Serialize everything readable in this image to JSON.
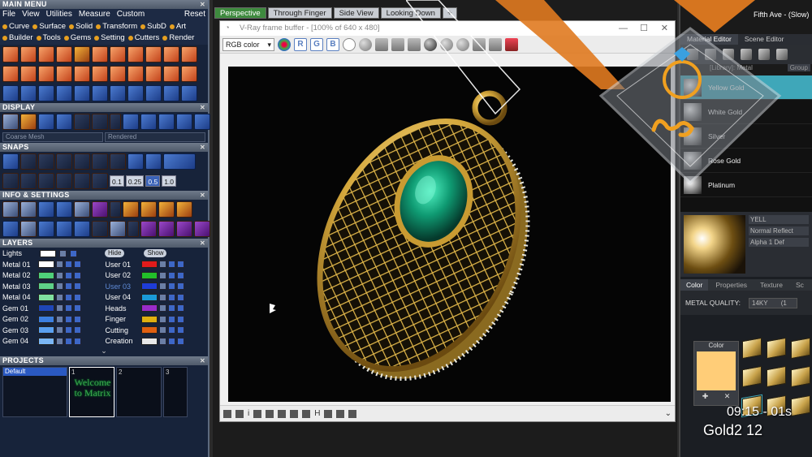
{
  "main_menu": {
    "title": "MAIN MENU",
    "menus": [
      "File",
      "View",
      "Utilities",
      "Measure",
      "Custom"
    ],
    "reset": "Reset",
    "submenus": [
      "Curve",
      "Surface",
      "Solid",
      "Transform",
      "SubD",
      "Art",
      "Builder",
      "Tools",
      "Gems",
      "Setting",
      "Cutters",
      "Render"
    ]
  },
  "display": {
    "title": "DISPLAY",
    "mesh_select": "Coarse Mesh",
    "render_select": "Rendered"
  },
  "snaps": {
    "title": "SNAPS",
    "values": [
      "0.1",
      "0.25",
      "0.5",
      "1.0"
    ]
  },
  "info": {
    "title": "INFO & SETTINGS"
  },
  "layers": {
    "title": "LAYERS",
    "lights": "Lights",
    "hide": "Hide",
    "show": "Show",
    "left": [
      {
        "name": "Metal 01",
        "color": "#ffffff"
      },
      {
        "name": "Metal 02",
        "color": "#4fd07a"
      },
      {
        "name": "Metal 03",
        "color": "#5ed088"
      },
      {
        "name": "Metal 04",
        "color": "#7fe0a0"
      },
      {
        "name": "Gem 01",
        "color": "#1e46b8"
      },
      {
        "name": "Gem 02",
        "color": "#3c7fe0"
      },
      {
        "name": "Gem 03",
        "color": "#5aa0f0"
      },
      {
        "name": "Gem 04",
        "color": "#7ab6f5"
      }
    ],
    "right": [
      {
        "name": "User 01",
        "color": "#e11b1b"
      },
      {
        "name": "User 02",
        "color": "#22c02a"
      },
      {
        "name": "User 03",
        "color": "#1e3cd8"
      },
      {
        "name": "User 04",
        "color": "#1a9ad8"
      },
      {
        "name": "Heads",
        "color": "#9a2cc8"
      },
      {
        "name": "Finger",
        "color": "#e0b010"
      },
      {
        "name": "Cutting",
        "color": "#e06010"
      },
      {
        "name": "Creation",
        "color": "#e8e8e8"
      }
    ]
  },
  "projects": {
    "title": "PROJECTS",
    "default": "Default",
    "slots": [
      "1",
      "2",
      "3"
    ],
    "welcome": "Welcome to Matrix"
  },
  "viewport_tabs": [
    "Perspective",
    "Through Finger",
    "Side View",
    "Looking Down",
    "+"
  ],
  "vray": {
    "title": "V-Ray frame buffer - [100% of 640 x 480]",
    "channel": "RGB color",
    "r": "R",
    "g": "G",
    "b": "B"
  },
  "right_panel": {
    "title": "Fifth Ave - (Slow)",
    "tabs": [
      "Material Editor",
      "Scene Editor"
    ],
    "group_label": "[Library]: Metal",
    "group_value": "Group",
    "materials": [
      "Yellow Gold",
      "White Gold",
      "Silver",
      "Rose Gold",
      "Platinum"
    ],
    "preview_label": "YELL",
    "reflect": "Normal Reflect",
    "alpha": "Alpha",
    "alpha_val": "1",
    "def": "Def",
    "sub_tabs": [
      "Color",
      "Properties",
      "Texture",
      "Sc"
    ],
    "metal_quality_label": "METAL QUALITY:",
    "metal_quality_value": "14KY",
    "metal_quality_extra": "(1",
    "color_label": "Color",
    "swatch_color": "#ffcd78"
  },
  "overlay_text": {
    "timestamp": "09:15 - 01s",
    "label": "Gold2 12"
  }
}
